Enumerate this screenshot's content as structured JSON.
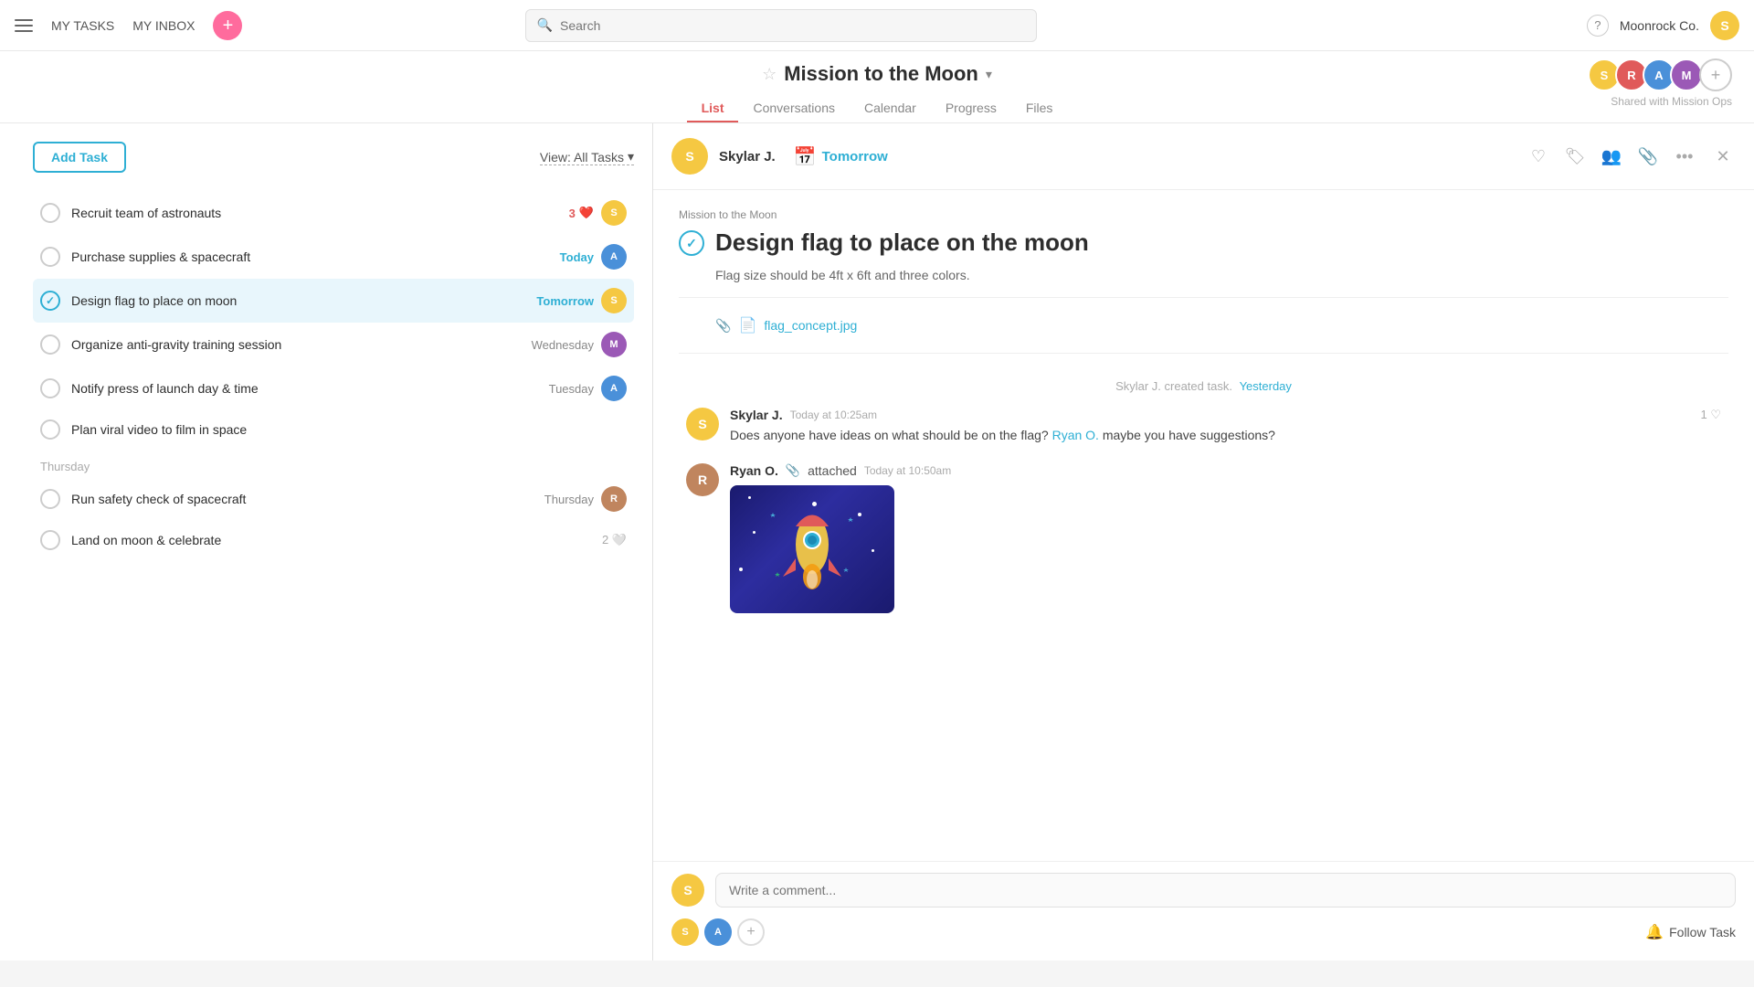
{
  "nav": {
    "my_tasks": "MY TASKS",
    "my_inbox": "MY INBOX",
    "search_placeholder": "Search",
    "org_name": "Moonrock Co.",
    "help": "?"
  },
  "project": {
    "title": "Mission to the Moon",
    "tabs": [
      "List",
      "Conversations",
      "Calendar",
      "Progress",
      "Files"
    ],
    "active_tab": "List",
    "shared_label": "Shared with Mission Ops"
  },
  "task_list": {
    "add_task_label": "Add Task",
    "view_filter_label": "View: All Tasks",
    "tasks": [
      {
        "id": 1,
        "name": "Recruit team of astronauts",
        "date": "",
        "date_class": "",
        "likes": 3,
        "active": false,
        "checked": false
      },
      {
        "id": 2,
        "name": "Purchase supplies & spacecraft",
        "date": "Today",
        "date_class": "today",
        "likes": 0,
        "active": false,
        "checked": false
      },
      {
        "id": 3,
        "name": "Design flag to place on moon",
        "date": "Tomorrow",
        "date_class": "tomorrow",
        "likes": 0,
        "active": true,
        "checked": true
      },
      {
        "id": 4,
        "name": "Organize anti-gravity training session",
        "date": "Wednesday",
        "date_class": "normal",
        "likes": 0,
        "active": false,
        "checked": false
      },
      {
        "id": 5,
        "name": "Notify press of launch day & time",
        "date": "Tuesday",
        "date_class": "normal",
        "likes": 0,
        "active": false,
        "checked": false
      },
      {
        "id": 6,
        "name": "Plan viral video to film in space",
        "date": "",
        "date_class": "",
        "likes": 0,
        "active": false,
        "checked": false
      },
      {
        "id": 7,
        "name": "Run safety check of spacecraft",
        "date": "Thursday",
        "date_class": "normal",
        "likes": 0,
        "active": false,
        "checked": false
      },
      {
        "id": 8,
        "name": "Land on moon & celebrate",
        "date": "",
        "date_class": "",
        "likes": 2,
        "active": false,
        "checked": false
      }
    ]
  },
  "detail": {
    "assignee": "Skylar J.",
    "due_label": "Tomorrow",
    "project_label": "Mission to the Moon",
    "task_title": "Design flag to place on the moon",
    "task_desc": "Flag size should be 4ft x 6ft and three colors.",
    "attachment_name": "flag_concept.jpg",
    "created_label": "Skylar J. created task.",
    "created_when": "Yesterday",
    "messages": [
      {
        "author": "Skylar J.",
        "time": "Today at 10:25am",
        "text": "Does anyone have ideas on what should be on the flag?",
        "mention": "Ryan O.",
        "mention_suffix": " maybe you have suggestions?",
        "likes": 1
      },
      {
        "author": "Ryan O.",
        "action": "attached",
        "time": "Today at 10:50am",
        "has_image": true
      }
    ],
    "comment_placeholder": "Write a comment...",
    "follow_task_label": "Follow Task"
  }
}
